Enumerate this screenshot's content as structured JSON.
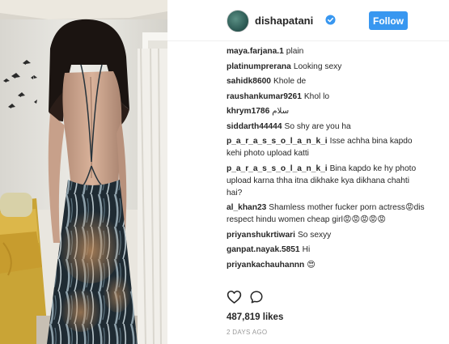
{
  "post": {
    "username": "dishapatani",
    "follow_label": "Follow",
    "likes": "487,819 likes",
    "timestamp": "2 DAYS AGO",
    "accent_color": "#3897f0"
  },
  "comments": [
    {
      "user": "maya.farjana.1",
      "text": "plain"
    },
    {
      "user": "platinumprerana",
      "text": "Looking sexy"
    },
    {
      "user": "sahidk8600",
      "text": "Khole de"
    },
    {
      "user": "raushankumar9261",
      "text": "Khol lo"
    },
    {
      "user": "khrym1786",
      "text": "سلام"
    },
    {
      "user": "siddarth44444",
      "text": "So shy are you ha"
    },
    {
      "user": "p_a_r_a_s_s_o_l_a_n_k_i",
      "text": "Isse achha bina kapdo kehi photo upload katti"
    },
    {
      "user": "p_a_r_a_s_s_o_l_a_n_k_i",
      "text": "Bina kapdo ke hy photo upload karna thha itna dikhake kya dikhana chahti hai?"
    },
    {
      "user": "al_khan23",
      "text": "Shamless mother fucker porn actress😡dis respect hindu women cheap girl😡😡😡😡😡"
    },
    {
      "user": "priyanshukrtiwari",
      "text": "So sexyy"
    },
    {
      "user": "ganpat.nayak.5851",
      "text": "Hi"
    },
    {
      "user": "priyankachauhannn",
      "text": "😍"
    }
  ],
  "icons": {
    "verified": "verified-badge-icon",
    "like": "heart-icon",
    "comment": "comment-icon"
  }
}
